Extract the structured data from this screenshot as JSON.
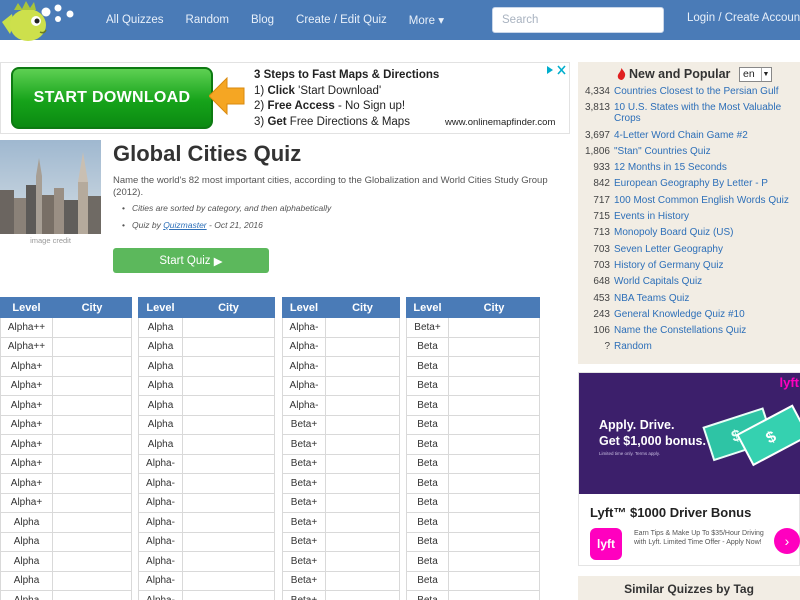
{
  "nav": {
    "links": [
      "All Quizzes",
      "Random",
      "Blog",
      "Create / Edit Quiz",
      "More"
    ],
    "more_caret": "▾",
    "search_placeholder": "Search",
    "login": "Login / Create Account"
  },
  "ad": {
    "button": "START DOWNLOAD",
    "heading": "3 Steps to Fast Maps & Directions",
    "step1_num": "1)",
    "step1_bold": "Click",
    "step1_rest": " 'Start Download'",
    "step2_num": "2)",
    "step2_bold": "Free Access",
    "step2_rest": " - No Sign up!",
    "step3_num": "3)",
    "step3_bold": "Get",
    "step3_rest": " Free Directions & Maps",
    "url": "www.onlinemapfinder.com"
  },
  "quiz": {
    "title": "Global Cities Quiz",
    "description": "Name the world's 82 most important cities, according to the Globalization and World Cities Study Group (2012).",
    "bullet1": "Cities are sorted by category, and then alphabetically",
    "bullet2_prefix": "Quiz by ",
    "bullet2_author": "Quizmaster",
    "bullet2_suffix": " - Oct 21, 2016",
    "image_credit": "image credit",
    "start_button": "Start Quiz",
    "start_glyph": "▶"
  },
  "tables": {
    "header_level": "Level",
    "header_city": "City",
    "t1": [
      "Alpha++",
      "Alpha++",
      "Alpha+",
      "Alpha+",
      "Alpha+",
      "Alpha+",
      "Alpha+",
      "Alpha+",
      "Alpha+",
      "Alpha+",
      "Alpha",
      "Alpha",
      "Alpha",
      "Alpha",
      "Alpha"
    ],
    "t2": [
      "Alpha",
      "Alpha",
      "Alpha",
      "Alpha",
      "Alpha",
      "Alpha",
      "Alpha",
      "Alpha-",
      "Alpha-",
      "Alpha-",
      "Alpha-",
      "Alpha-",
      "Alpha-",
      "Alpha-",
      "Alpha-"
    ],
    "t3": [
      "Alpha-",
      "Alpha-",
      "Alpha-",
      "Alpha-",
      "Alpha-",
      "Beta+",
      "Beta+",
      "Beta+",
      "Beta+",
      "Beta+",
      "Beta+",
      "Beta+",
      "Beta+",
      "Beta+",
      "Beta+"
    ],
    "t4": [
      "Beta+",
      "Beta",
      "Beta",
      "Beta",
      "Beta",
      "Beta",
      "Beta",
      "Beta",
      "Beta",
      "Beta",
      "Beta",
      "Beta",
      "Beta",
      "Beta",
      "Beta"
    ]
  },
  "sidebar": {
    "title": "New and Popular",
    "lang": "en",
    "items": [
      {
        "count": "4,334",
        "title": "Countries Closest to the Persian Gulf"
      },
      {
        "count": "3,813",
        "title": "10 U.S. States with the Most Valuable Crops"
      },
      {
        "count": "3,697",
        "title": "4-Letter Word Chain Game #2"
      },
      {
        "count": "1,806",
        "title": "\"Stan\" Countries Quiz"
      },
      {
        "count": "933",
        "title": "12 Months in 15 Seconds"
      },
      {
        "count": "842",
        "title": "European Geography By Letter - P"
      },
      {
        "count": "717",
        "title": "100 Most Common English Words Quiz"
      },
      {
        "count": "715",
        "title": "Events in History"
      },
      {
        "count": "713",
        "title": "Monopoly Board Quiz (US)"
      },
      {
        "count": "703",
        "title": "Seven Letter Geography"
      },
      {
        "count": "703",
        "title": "History of Germany Quiz"
      },
      {
        "count": "648",
        "title": "World Capitals Quiz"
      },
      {
        "count": "453",
        "title": "NBA Teams Quiz"
      },
      {
        "count": "243",
        "title": "General Knowledge Quiz #10"
      },
      {
        "count": "106",
        "title": "Name the Constellations Quiz"
      },
      {
        "count": "?",
        "title": "Random"
      }
    ]
  },
  "lyft": {
    "brand": "lyft",
    "line1": "Apply. Drive.",
    "line2": "Get $1,000 bonus.",
    "fine_print": "Limited time only. Terms apply.",
    "title": "Lyft™ $1000 Driver Bonus",
    "desc": "Earn Tips & Make Up To $35/Hour Driving with Lyft. Limited Time Offer - Apply Now!",
    "go": "›"
  },
  "similar": {
    "title": "Similar Quizzes by Tag"
  },
  "colors": {
    "nav": "#4a7bb7",
    "link": "#2d6fb8",
    "sidebar_bg": "#f2ede4",
    "start_green": "#5cb85c",
    "lyft_pink": "#ff00bf",
    "lyft_purple": "#3c1f6b"
  }
}
